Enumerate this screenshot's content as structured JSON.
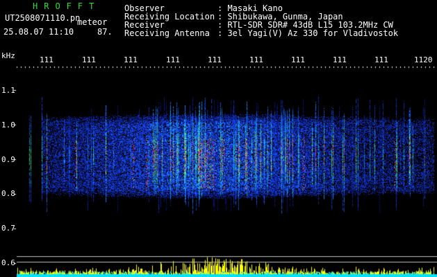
{
  "header": {
    "title": "HROFFT",
    "filename": "UT2508071110.pn",
    "mode_label": "meteor",
    "datetime": "25.08.07 11:10",
    "count": "87."
  },
  "info": {
    "labels": [
      "Observer",
      "Receiving Location",
      "Receiver",
      "Receiving Antenna"
    ],
    "values": [
      ": Masaki Kano",
      ": Shibukawa, Gunma, Japan",
      ": RTL-SDR SDR# 43dB L15 103.2MHz CW",
      ": 3el Yagi(V) Az 330 for Vladivostok"
    ]
  },
  "time_axis": {
    "ticks": [
      "111",
      "111",
      "111",
      "111",
      "111",
      "111",
      "111",
      "111",
      "111",
      "1120"
    ]
  },
  "freq_axis": {
    "unit": "kHz",
    "ticks": [
      "1.1",
      "1.0",
      "0.9",
      "0.8",
      "0.7",
      "0.6"
    ]
  },
  "colors": {
    "background": "#000000",
    "title": "#33dd33",
    "text": "#ffffff",
    "signal_low": "#1020a0",
    "signal_mid": "#20c0ff",
    "signal_high": "#ff2060",
    "activity_bar": "#ffff00",
    "baseline": "#00e0ff"
  }
}
